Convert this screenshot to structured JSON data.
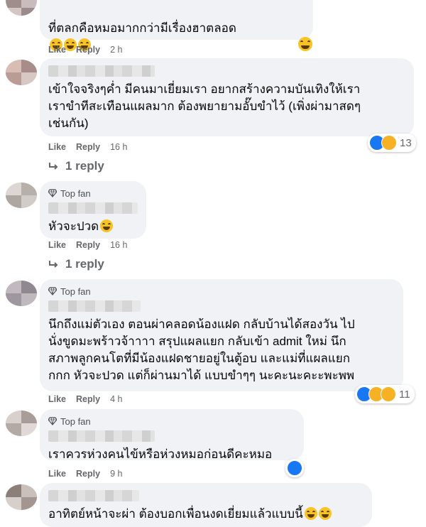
{
  "colors": {
    "bubble": "#f0f2f5",
    "meta_text": "#65676b",
    "like_blue": "#1877f2",
    "emoji_yellow": "#f7b125"
  },
  "labels": {
    "like": "Like",
    "reply": "Reply",
    "top_fan": "Top fan"
  },
  "comments": [
    {
      "text": "ที่ตลกคือหมอมากกว่ามีเรื่องฮาตลอด",
      "time": "2 h",
      "emojis": [
        "grin-icon",
        "grin-icon",
        "grin-icon",
        "laugh-icon"
      ]
    },
    {
      "text": "เข้าใจจริงๆค่ำ มีคนมาเยี่ยมเรา อยากสร้างความบันเทิงให้เรา\nเราขำทีสะเทือนแผลมาก ต้องพยายามอั๊บขำไว้ (เพิ่งผ่ามาสดๆ\nเช่นกัน)",
      "time": "16 h",
      "reaction_count": "13",
      "reactions": [
        "like-icon",
        "haha-icon"
      ],
      "replies": "1 reply"
    },
    {
      "text": "หัวจะปวด",
      "time": "16 h",
      "top_fan": true,
      "emojis": [
        "laugh-icon"
      ],
      "replies": "1 reply"
    },
    {
      "text": "นึกถึงแม่ตัวเอง ตอนผ่าคลอดน้องแฝด กลับบ้านได้สองวัน ไป\nนั่งขูดมะพร้าวจ้าาาา สรุปแผลแยก กลับเข้า admit ใหม่ นึก\nสภาพลูกคนโตที่มีน้องแฝดชายอยู่ในตู้อบ และแม่ที่แผลแยก\nกกก หัวจะปวด แต่ก็ผ่านมาได้ แบบขำๆๆ นะคะนะคะะพะพพ",
      "time": "4 h",
      "top_fan": true,
      "reaction_count": "11",
      "reactions": [
        "like-icon",
        "haha-icon",
        "wow-icon"
      ]
    },
    {
      "text": "เราควรห่วงคนไข้หรือห่วงหมอก่อนดีคะหมอ",
      "time": "9 h",
      "top_fan": true,
      "reactions": [
        "like-icon"
      ]
    },
    {
      "text": "อาทิตย์หน้าจะผ่า ต้องบอกเพื่อนงดเยี่ยมแล้วแบบนี้",
      "emojis": [
        "grin-icon",
        "grin-icon"
      ]
    }
  ]
}
